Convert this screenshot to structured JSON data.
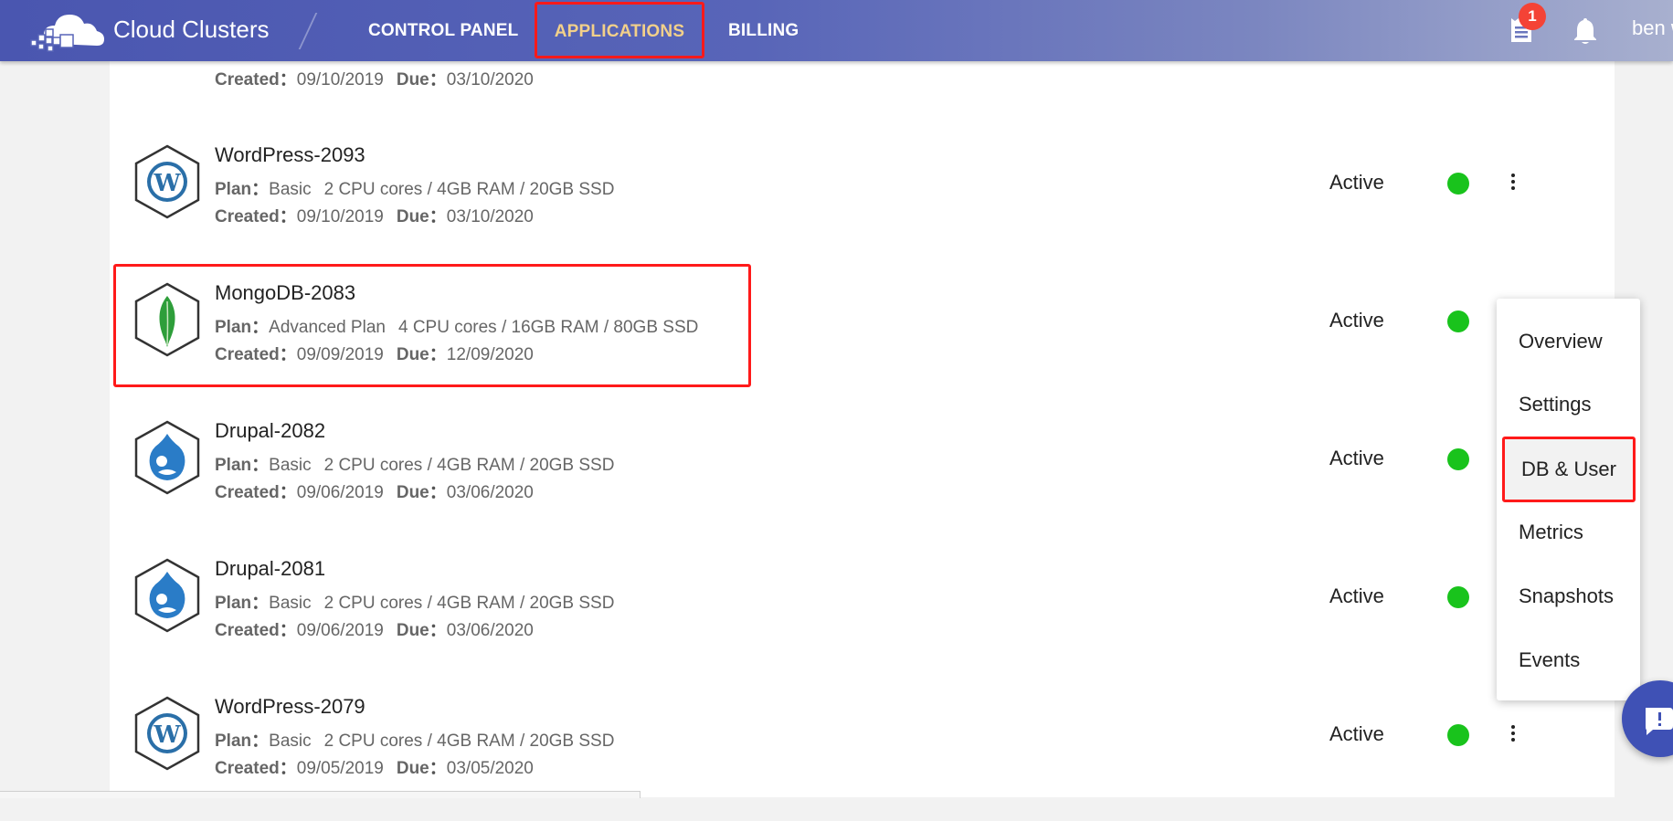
{
  "header": {
    "brand": "Cloud Clusters",
    "nav": {
      "control_panel": "CONTROL PANEL",
      "applications": "APPLICATIONS",
      "billing": "BILLING"
    },
    "notification_count": "1",
    "user": "ben w"
  },
  "apps": [
    {
      "name": "",
      "plan_label": "",
      "plan": "",
      "specs": "",
      "created_label": "Created",
      "created": "09/10/2019",
      "due_label": "Due",
      "due": "03/10/2020",
      "icon": "wordpress-icon",
      "status": ""
    },
    {
      "name": "WordPress-2093",
      "plan_label": "Plan",
      "plan": "Basic",
      "specs": "2 CPU cores / 4GB RAM / 20GB SSD",
      "created_label": "Created",
      "created": "09/10/2019",
      "due_label": "Due",
      "due": "03/10/2020",
      "icon": "wordpress-icon",
      "status": "Active"
    },
    {
      "name": "MongoDB-2083",
      "plan_label": "Plan",
      "plan": "Advanced Plan",
      "specs": "4 CPU cores / 16GB RAM / 80GB SSD",
      "created_label": "Created",
      "created": "09/09/2019",
      "due_label": "Due",
      "due": "12/09/2020",
      "icon": "mongodb-leaf-icon",
      "status": "Active"
    },
    {
      "name": "Drupal-2082",
      "plan_label": "Plan",
      "plan": "Basic",
      "specs": "2 CPU cores / 4GB RAM / 20GB SSD",
      "created_label": "Created",
      "created": "09/06/2019",
      "due_label": "Due",
      "due": "03/06/2020",
      "icon": "drupal-icon",
      "status": "Active"
    },
    {
      "name": "Drupal-2081",
      "plan_label": "Plan",
      "plan": "Basic",
      "specs": "2 CPU cores / 4GB RAM / 20GB SSD",
      "created_label": "Created",
      "created": "09/06/2019",
      "due_label": "Due",
      "due": "03/06/2020",
      "icon": "drupal-icon",
      "status": "Active"
    },
    {
      "name": "WordPress-2079",
      "plan_label": "Plan",
      "plan": "Basic",
      "specs": "2 CPU cores / 4GB RAM / 20GB SSD",
      "created_label": "Created",
      "created": "09/05/2019",
      "due_label": "Due",
      "due": "03/05/2020",
      "icon": "wordpress-icon",
      "status": "Active"
    }
  ],
  "menu": {
    "items": [
      "Overview",
      "Settings",
      "DB & User",
      "Metrics",
      "Snapshots",
      "Events"
    ],
    "selected": "DB & User"
  },
  "colors": {
    "header_start": "#4a56b0",
    "nav_active": "#f2d08a",
    "highlight": "#ff1a1a",
    "status_active": "#19c31c",
    "badge": "#f44336",
    "fab": "#3f51b5"
  }
}
